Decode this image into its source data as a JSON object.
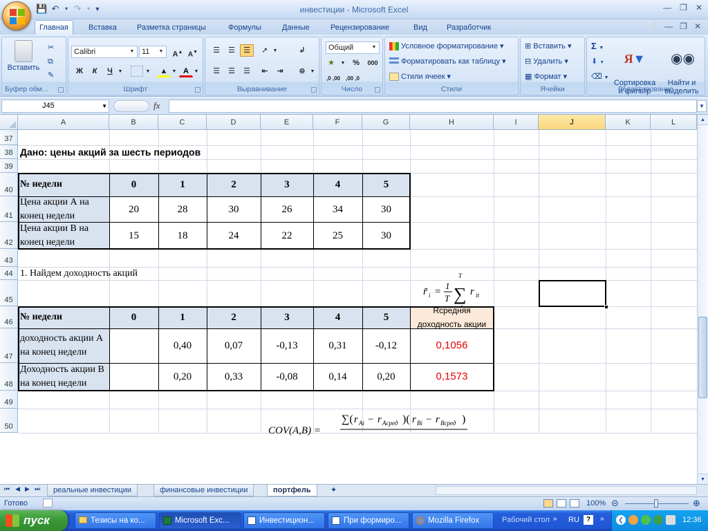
{
  "window": {
    "title": "инвестиции - Microsoft Excel"
  },
  "ribbon": {
    "tabs": [
      "Главная",
      "Вставка",
      "Разметка страницы",
      "Формулы",
      "Данные",
      "Рецензирование",
      "Вид",
      "Разработчик"
    ],
    "active_tab": "Главная",
    "clipboard": {
      "label": "Буфер обм...",
      "paste": "Вставить"
    },
    "font": {
      "label": "Шрифт",
      "name": "Calibri",
      "size": "11",
      "bold": "Ж",
      "italic": "К",
      "underline": "Ч"
    },
    "alignment": {
      "label": "Выравнивание"
    },
    "number": {
      "label": "Число",
      "format": "Общий",
      "percent": "%",
      "thousands": "000"
    },
    "styles": {
      "label": "Стили",
      "conditional": "Условное форматирование",
      "as_table": "Форматировать как таблицу",
      "cell_styles": "Стили ячеек"
    },
    "cells": {
      "label": "Ячейки",
      "insert": "Вставить",
      "delete": "Удалить",
      "format": "Формат"
    },
    "editing": {
      "label": "Редактирование",
      "sort_filter": "Сортировка\nи фильтр",
      "find_select": "Найти и\nвыделить"
    }
  },
  "formula_bar": {
    "name_box": "J45",
    "fx": "fx",
    "value": ""
  },
  "columns": [
    "A",
    "B",
    "C",
    "D",
    "E",
    "F",
    "G",
    "H",
    "I",
    "J",
    "K",
    "L"
  ],
  "selected_column": "J",
  "rows": [
    "37",
    "38",
    "39",
    "40",
    "41",
    "42",
    "43",
    "44",
    "45",
    "46",
    "47",
    "48",
    "49",
    "50"
  ],
  "sheet": {
    "heading": "Дано: цены акций за шесть периодов",
    "table1": {
      "header_label": "№ недели",
      "periods": [
        "0",
        "1",
        "2",
        "3",
        "4",
        "5"
      ],
      "rows": [
        {
          "label": "Цена акции А на конец недели",
          "values": [
            "20",
            "28",
            "30",
            "26",
            "34",
            "30"
          ]
        },
        {
          "label": "Цена акции В на конец недели",
          "values": [
            "15",
            "18",
            "24",
            "22",
            "25",
            "30"
          ]
        }
      ]
    },
    "step1": "1. Найдем доходность акций",
    "table2": {
      "header_label": "№ недели",
      "periods": [
        "0",
        "1",
        "2",
        "3",
        "4",
        "5"
      ],
      "avg_header": "Rсредняя доходность акции",
      "rows": [
        {
          "label": "доходность акции А на конец недели",
          "values": [
            "",
            "0,40",
            "0,07",
            "-0,13",
            "0,31",
            "-0,12"
          ],
          "avg": "0,1056"
        },
        {
          "label": "Доходность акции В на конец недели",
          "values": [
            "",
            "0,20",
            "0,33",
            "-0,08",
            "0,14",
            "0,20"
          ],
          "avg": "0,1573"
        }
      ]
    }
  },
  "sheet_tabs": [
    "реальные инвестиции",
    "финансовые инвестиции",
    "портфель"
  ],
  "active_sheet": "портфель",
  "status": {
    "ready": "Готово",
    "zoom": "100%"
  },
  "taskbar": {
    "start": "пуск",
    "items": [
      "Тезисы на ко...",
      "Microsoft Exc...",
      "Инвестицион...",
      "При формиро...",
      "Mozilla Firefox"
    ],
    "active_item": "Microsoft Exc...",
    "desktop": "Рабочий стол",
    "lang": "RU",
    "clock": "12:36"
  },
  "colors": {
    "accent_red": "#e30000",
    "header_fill": "#d9e2ef",
    "avg_fill": "#fde9d9"
  }
}
